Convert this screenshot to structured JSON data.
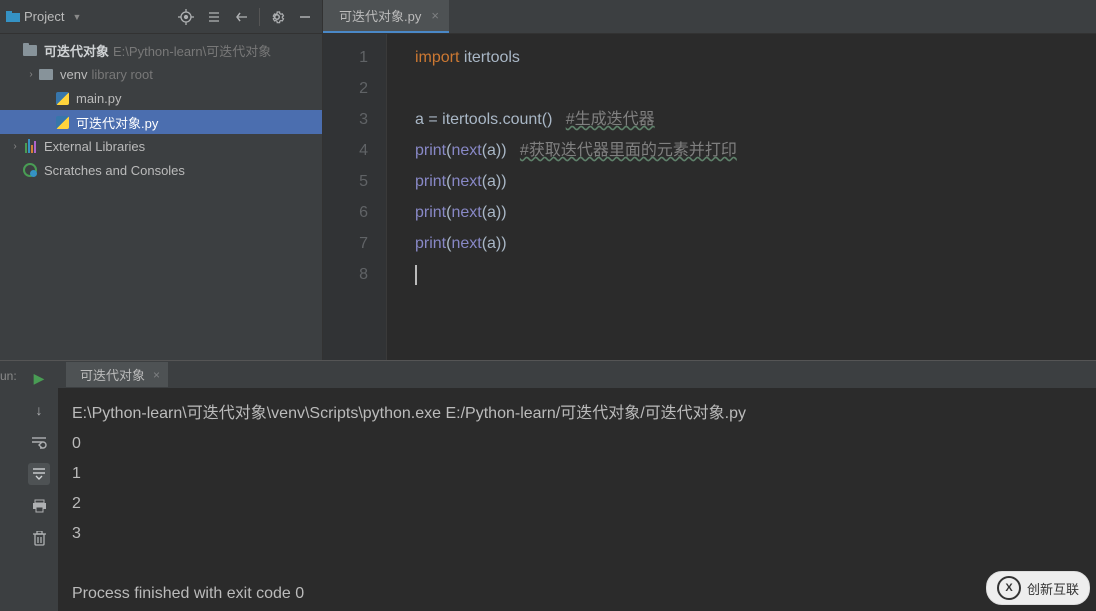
{
  "sidebar": {
    "title": "Project",
    "root": {
      "name": "可迭代对象",
      "path": "E:\\Python-learn\\可迭代对象"
    },
    "venv": {
      "name": "venv",
      "hint": "library root"
    },
    "files": [
      {
        "name": "main.py"
      },
      {
        "name": "可迭代对象.py",
        "selected": true
      }
    ],
    "ext_lib": "External Libraries",
    "scratches": "Scratches and Consoles"
  },
  "tabs": [
    {
      "name": "可迭代对象.py"
    }
  ],
  "code": {
    "lines": [
      {
        "n": "1",
        "seg": [
          {
            "t": "import ",
            "c": "kw"
          },
          {
            "t": "itertools",
            "c": ""
          }
        ]
      },
      {
        "n": "2",
        "seg": []
      },
      {
        "n": "3",
        "seg": [
          {
            "t": "a = itertools.count()   ",
            "c": ""
          },
          {
            "t": "#生成迭代器",
            "c": "cm yu"
          }
        ]
      },
      {
        "n": "4",
        "seg": [
          {
            "t": "print",
            "c": "bi"
          },
          {
            "t": "(",
            "c": ""
          },
          {
            "t": "next",
            "c": "bi"
          },
          {
            "t": "(a))   ",
            "c": ""
          },
          {
            "t": "#获取迭代器里面的元素并打印",
            "c": "cm yu"
          }
        ]
      },
      {
        "n": "5",
        "seg": [
          {
            "t": "print",
            "c": "bi"
          },
          {
            "t": "(",
            "c": ""
          },
          {
            "t": "next",
            "c": "bi"
          },
          {
            "t": "(a))",
            "c": ""
          }
        ]
      },
      {
        "n": "6",
        "seg": [
          {
            "t": "print",
            "c": "bi"
          },
          {
            "t": "(",
            "c": ""
          },
          {
            "t": "next",
            "c": "bi"
          },
          {
            "t": "(a))",
            "c": ""
          }
        ]
      },
      {
        "n": "7",
        "seg": [
          {
            "t": "print",
            "c": "bi"
          },
          {
            "t": "(",
            "c": ""
          },
          {
            "t": "next",
            "c": "bi"
          },
          {
            "t": "(a))",
            "c": ""
          }
        ]
      },
      {
        "n": "8",
        "seg": [],
        "caret": true
      }
    ]
  },
  "run": {
    "label": "un:",
    "tab": "可迭代对象",
    "lines": [
      "E:\\Python-learn\\可迭代对象\\venv\\Scripts\\python.exe E:/Python-learn/可迭代对象/可迭代对象.py",
      "0",
      "1",
      "2",
      "3",
      "",
      "Process finished with exit code 0"
    ]
  },
  "watermark": "创新互联"
}
